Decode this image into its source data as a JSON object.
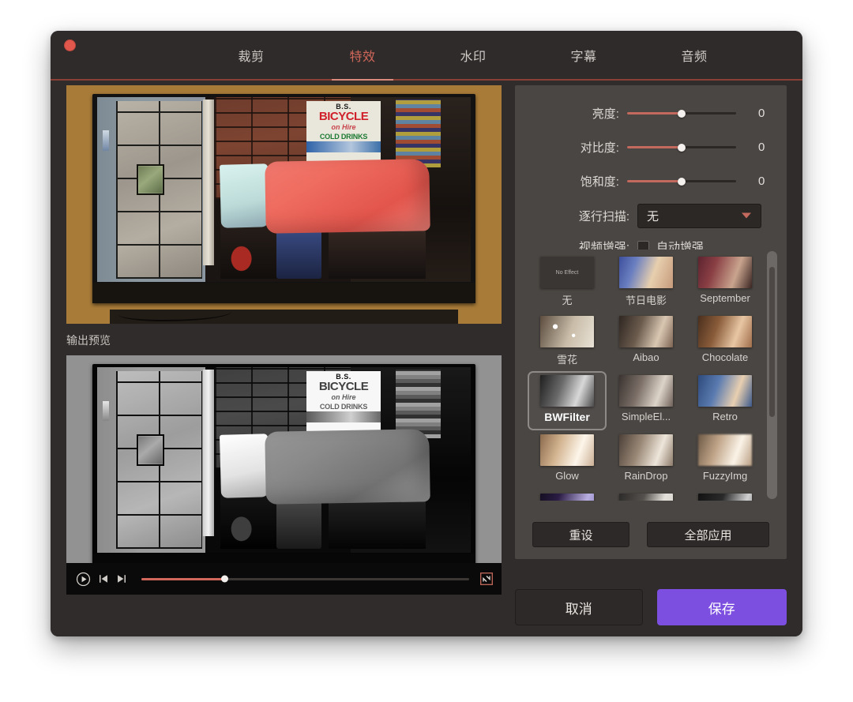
{
  "window": {
    "close_button": "close",
    "accent_red": "#d2675a",
    "accent_purple": "#7d4fe0"
  },
  "tabs": [
    {
      "label": "裁剪",
      "active": false
    },
    {
      "label": "特效",
      "active": true
    },
    {
      "label": "水印",
      "active": false
    },
    {
      "label": "字幕",
      "active": false
    },
    {
      "label": "音频",
      "active": false
    }
  ],
  "preview": {
    "output_label": "输出预览",
    "source_scene": {
      "sign_line1": "B.S.",
      "sign_line2": "BICYCLE",
      "sign_line3": "on Hire",
      "sign_line4": "COLD DRINKS"
    }
  },
  "player": {
    "play_icon": "play-circle-icon",
    "prev_icon": "skip-previous-icon",
    "next_icon": "skip-next-icon",
    "fullscreen_icon": "fullscreen-icon",
    "progress_percent": 25.5
  },
  "adjustments": [
    {
      "label": "亮度:",
      "value": "0",
      "percent": 50
    },
    {
      "label": "对比度:",
      "value": "0",
      "percent": 50
    },
    {
      "label": "饱和度:",
      "value": "0",
      "percent": 50
    }
  ],
  "deinterlace": {
    "label": "逐行扫描:",
    "selected": "无",
    "caret_icon": "chevron-down-icon"
  },
  "enhance": {
    "label": "视频增强:",
    "checkbox_label": "自动增强",
    "checked": false
  },
  "filters": [
    {
      "name": "无",
      "thumb": "no-effect",
      "selected": false
    },
    {
      "name": "节日电影",
      "thumb": "holiday",
      "selected": false
    },
    {
      "name": "September",
      "thumb": "september",
      "selected": false
    },
    {
      "name": "雪花",
      "thumb": "snow",
      "selected": false
    },
    {
      "name": "Aibao",
      "thumb": "aibao",
      "selected": false
    },
    {
      "name": "Chocolate",
      "thumb": "chocolate",
      "selected": false
    },
    {
      "name": "BWFilter",
      "thumb": "bw",
      "selected": true
    },
    {
      "name": "SimpleEl...",
      "thumb": "simple",
      "selected": false
    },
    {
      "name": "Retro",
      "thumb": "retro",
      "selected": false
    },
    {
      "name": "Glow",
      "thumb": "glow",
      "selected": false
    },
    {
      "name": "RainDrop",
      "thumb": "raindrop",
      "selected": false
    },
    {
      "name": "FuzzyImg",
      "thumb": "fuzzy",
      "selected": false
    },
    {
      "name": "",
      "thumb": "partial-purple",
      "selected": false
    },
    {
      "name": "",
      "thumb": "partial-gray",
      "selected": false
    },
    {
      "name": "",
      "thumb": "partial-dark",
      "selected": false
    }
  ],
  "panel_actions": {
    "reset": "重设",
    "apply_all": "全部应用"
  },
  "dialog_actions": {
    "cancel": "取消",
    "save": "保存"
  }
}
